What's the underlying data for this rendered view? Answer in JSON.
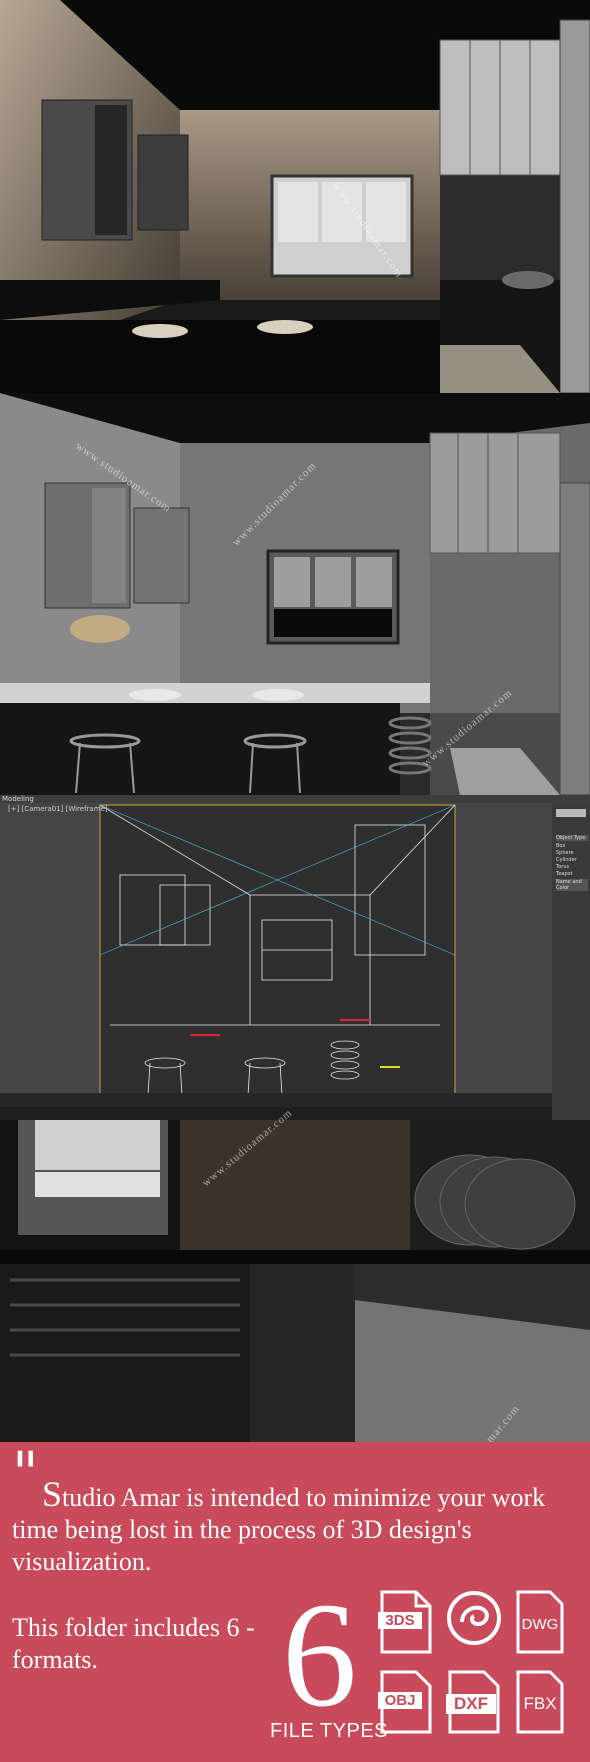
{
  "watermark": "www.studioamar.com",
  "viewport": {
    "title": "Modeling",
    "label": "[+] [Camera01] [Wireframe]",
    "panel_header": "Object Type",
    "panel_items": [
      "Box",
      "Sphere",
      "Cylinder",
      "Torus",
      "Teapot"
    ],
    "panel_footer": "Name and Color"
  },
  "promo": {
    "quote_mark": "\"",
    "mission_initial": "S",
    "mission_rest": "tudio Amar is intended to minimize your work time being lost in the process of 3D design's visualization.",
    "includes_text": "This folder includes 6 - formats.",
    "count": "6",
    "file_types_label": "FILE TYPES",
    "formats": [
      "3DS",
      "3ds-max-icon",
      "DWG",
      "OBJ",
      "DXF",
      "FBX"
    ],
    "background": "#c94a5b"
  }
}
